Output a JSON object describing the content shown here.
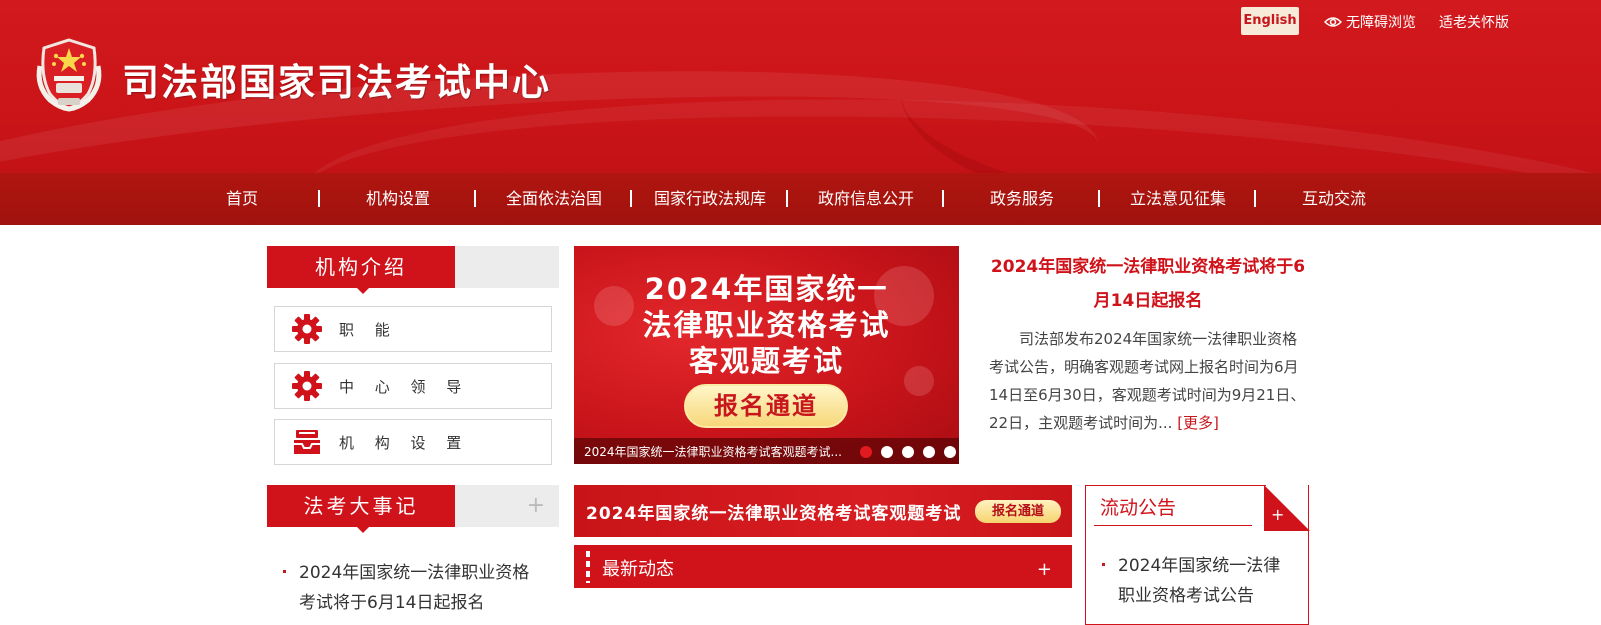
{
  "header": {
    "site_title": "司法部国家司法考试中心",
    "english_label": "English",
    "accessibility_label": "无障碍浏览",
    "elder_mode_label": "适老关怀版"
  },
  "nav": {
    "items": [
      "首页",
      "机构设置",
      "全面依法治国",
      "国家行政法规库",
      "政府信息公开",
      "政务服务",
      "立法意见征集",
      "互动交流"
    ]
  },
  "org_intro": {
    "title": "机构介绍",
    "buttons": [
      {
        "label": "职 能",
        "icon": "gear-icon"
      },
      {
        "label": "中 心 领 导",
        "icon": "gear-icon"
      },
      {
        "label": "机 构 设 置",
        "icon": "inbox-tray-icon"
      }
    ]
  },
  "events": {
    "title": "法考大事记",
    "plus": "+",
    "items": [
      "2024年国家统一法律职业资格考试将于6月14日起报名"
    ]
  },
  "banner": {
    "lines": [
      "2024年国家统一",
      "法律职业资格考试",
      "客观题考试"
    ],
    "button": "报名通道",
    "caption": "2024年国家统一法律职业资格考试客观题考试...",
    "active_slide": 1,
    "slide_count": 5
  },
  "top_news": {
    "title": "2024年国家统一法律职业资格考试将于6月14日起报名",
    "summary": "司法部发布2024年国家统一法律职业资格考试公告，明确客观题考试网上报名时间为6月14日至6月30日，客观题考试时间为9月21日、22日，主观题考试时间为...",
    "more": "[更多]"
  },
  "strip": {
    "text": "2024年国家统一法律职业资格考试客观题考试",
    "button": "报名通道"
  },
  "latest": {
    "title": "最新动态",
    "plus": "+"
  },
  "notice": {
    "title": "流动公告",
    "plus": "+",
    "items": [
      "2024年国家统一法律职业资格考试公告"
    ]
  },
  "colors": {
    "brand_red": "#d0121a",
    "nav_red": "#a9140f",
    "gold": "#f7d77a"
  }
}
